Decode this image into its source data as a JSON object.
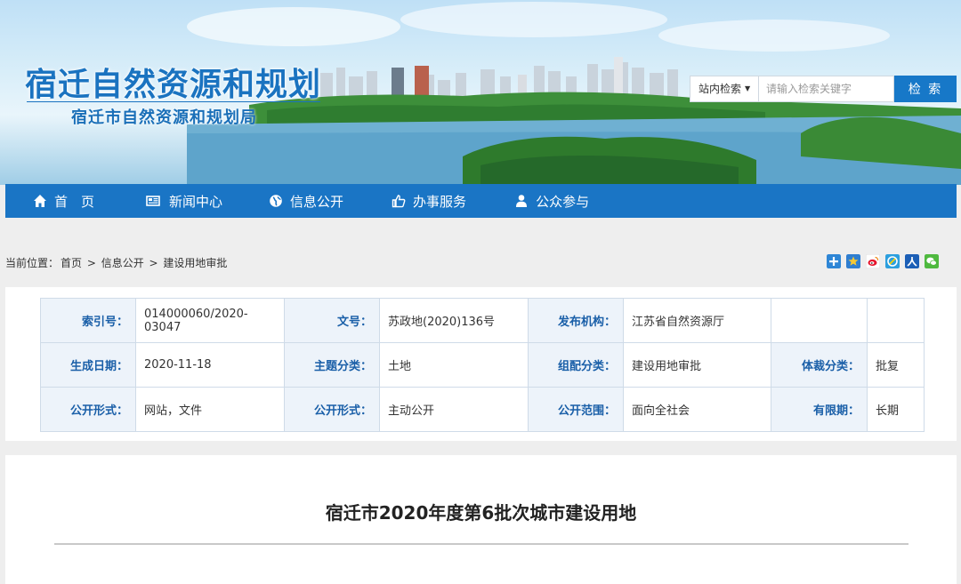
{
  "header": {
    "site_title": "宿迁自然资源和规划",
    "site_subtitle": "宿迁市自然资源和规划局"
  },
  "search": {
    "scope_label": "站内检索",
    "placeholder": "请输入检索关键字",
    "button_label": "检 索"
  },
  "nav": {
    "items": [
      {
        "label": "首　页",
        "icon": "home-icon"
      },
      {
        "label": "新闻中心",
        "icon": "newspaper-icon"
      },
      {
        "label": "信息公开",
        "icon": "globe-icon"
      },
      {
        "label": "办事服务",
        "icon": "thumbs-up-icon"
      },
      {
        "label": "公众参与",
        "icon": "user-icon"
      }
    ]
  },
  "breadcrumb": {
    "prefix": "当前位置：",
    "items": [
      "首页",
      "信息公开",
      "建设用地审批"
    ],
    "separator": " > "
  },
  "share_icons": [
    "add-icon",
    "star-icon",
    "weibo-icon",
    "qzone-icon",
    "renren-icon",
    "wechat-icon"
  ],
  "meta": {
    "rows": [
      [
        {
          "k": "索引号：",
          "v": "014000060/2020-03047"
        },
        {
          "k": "文号：",
          "v": "苏政地(2020)136号"
        },
        {
          "k": "发布机构：",
          "v": "江苏省自然资源厅"
        },
        {
          "k": "",
          "v": ""
        }
      ],
      [
        {
          "k": "生成日期：",
          "v": "2020-11-18"
        },
        {
          "k": "主题分类：",
          "v": "土地"
        },
        {
          "k": "组配分类：",
          "v": "建设用地审批"
        },
        {
          "k": "体裁分类：",
          "v": "批复"
        }
      ],
      [
        {
          "k": "公开形式：",
          "v": "网站，文件"
        },
        {
          "k": "公开形式：",
          "v": "主动公开"
        },
        {
          "k": "公开范围：",
          "v": "面向全社会"
        },
        {
          "k": "有限期：",
          "v": "长期"
        }
      ]
    ]
  },
  "article": {
    "title": "宿迁市2020年度第6批次城市建设用地"
  },
  "colors": {
    "nav_bg": "#1a75c5",
    "title_blue": "#1a73c0",
    "label_bg": "#edf3fa",
    "search_button": "#1778c8"
  }
}
